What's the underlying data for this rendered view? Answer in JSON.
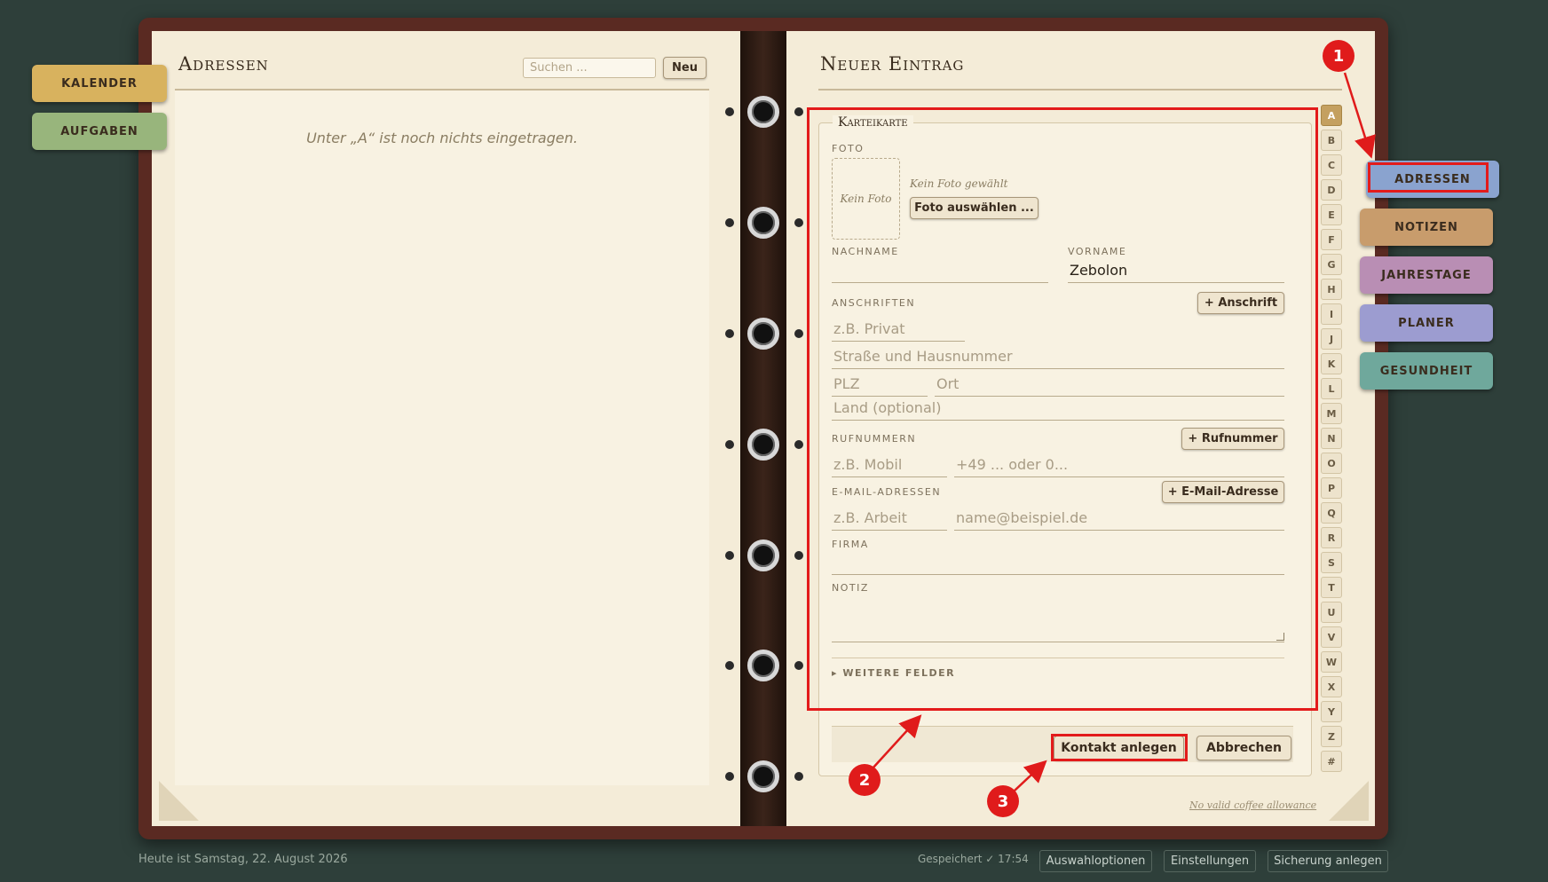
{
  "left_tabs": [
    {
      "label": "KALENDER",
      "color": "#d8b25e"
    },
    {
      "label": "AUFGABEN",
      "color": "#98b57c"
    }
  ],
  "right_tabs": [
    {
      "label": "ADRESSEN",
      "color": "#8aa3cf"
    },
    {
      "label": "NOTIZEN",
      "color": "#c89c6c"
    },
    {
      "label": "JAHRESTAGE",
      "color": "#b98eb4"
    },
    {
      "label": "PLANER",
      "color": "#9c9cd0"
    },
    {
      "label": "GESUNDHEIT",
      "color": "#6fa89c"
    }
  ],
  "left_page": {
    "title": "Adressen",
    "search_placeholder": "Suchen ...",
    "new_button": "Neu",
    "empty_message": "Unter „A“ ist noch nichts eingetragen."
  },
  "right_page": {
    "title": "Neuer Eintrag",
    "card_title": "Karteikarte",
    "foto_label": "FOTO",
    "photo_placeholder": "Kein Foto",
    "photo_status": "Kein Foto gewählt",
    "photo_button": "Foto auswählen ...",
    "nachname_label": "NACHNAME",
    "nachname_value": "",
    "vorname_label": "VORNAME",
    "vorname_value": "Zebolon",
    "anschriften_label": "ANSCHRIFTEN",
    "add_anschrift": "+ Anschrift",
    "address_label_ph": "z.B. Privat",
    "street_ph": "Straße und Hausnummer",
    "plz_ph": "PLZ",
    "ort_ph": "Ort",
    "land_ph": "Land (optional)",
    "rufnummern_label": "RUFNUMMERN",
    "add_rufnummer": "+ Rufnummer",
    "phone_label_ph": "z.B. Mobil",
    "phone_ph": "+49 ... oder 0...",
    "email_label": "E-MAIL-ADRESSEN",
    "add_email": "+ E-Mail-Adresse",
    "email_label_ph": "z.B. Arbeit",
    "email_ph": "name@beispiel.de",
    "firma_label": "FIRMA",
    "notiz_label": "NOTIZ",
    "weitere_felder": "▸ WEITERE FELDER",
    "create_button": "Kontakt anlegen",
    "cancel_button": "Abbrechen",
    "coffee_link": "No valid coffee allowance"
  },
  "alphabet": [
    "A",
    "B",
    "C",
    "D",
    "E",
    "F",
    "G",
    "H",
    "I",
    "J",
    "K",
    "L",
    "M",
    "N",
    "O",
    "P",
    "Q",
    "R",
    "S",
    "T",
    "U",
    "V",
    "W",
    "X",
    "Y",
    "Z",
    "#"
  ],
  "active_letter": "A",
  "footer": {
    "date_text": "Heute ist Samstag, 22. August 2026",
    "saved_text": "Gespeichert ✓ 17:54",
    "btn_auswahl": "Auswahloptionen",
    "btn_einstellungen": "Einstellungen",
    "btn_sicherung": "Sicherung anlegen"
  },
  "annotations": [
    "1",
    "2",
    "3"
  ],
  "annotation_color": "#e01b1b"
}
